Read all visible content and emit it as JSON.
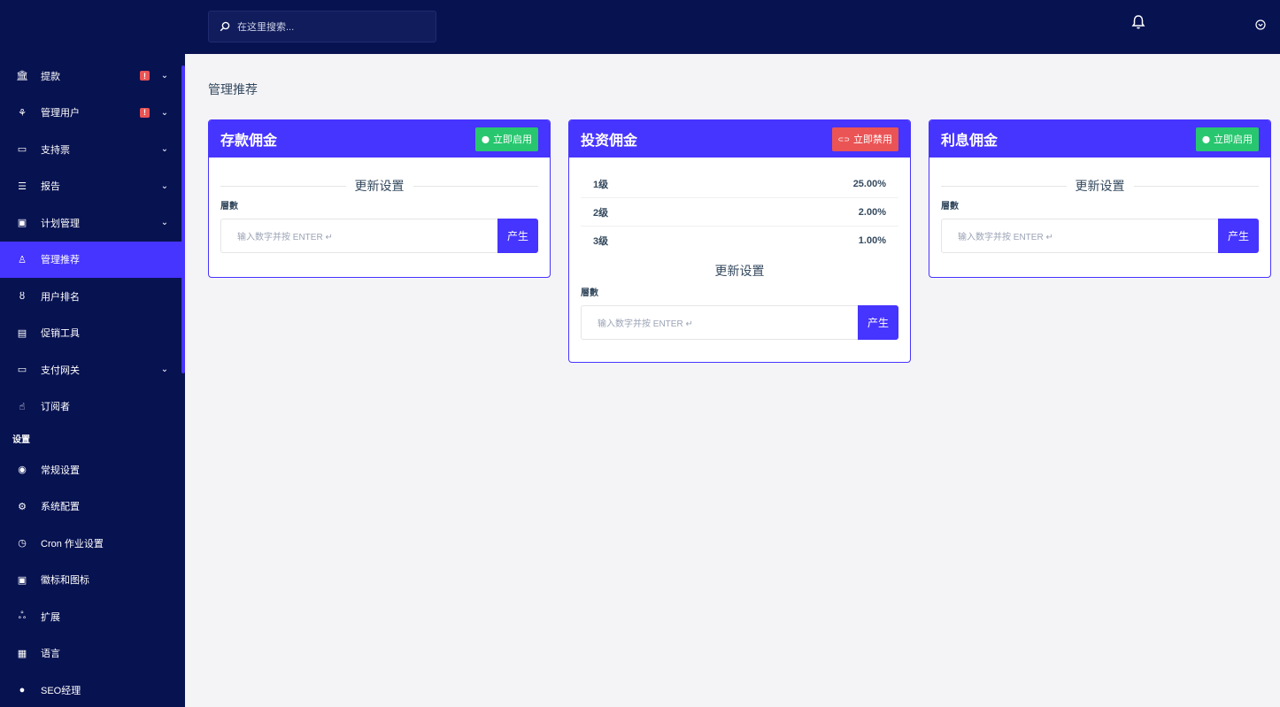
{
  "sidebar": {
    "items": [
      {
        "label": "提款",
        "icon": "bank-icon",
        "glyph": "🏛",
        "warn": true,
        "chevron": true,
        "active": false
      },
      {
        "label": "管理用户",
        "icon": "users-icon",
        "glyph": "⚘",
        "warn": true,
        "chevron": true,
        "active": false
      },
      {
        "label": "支持票",
        "icon": "ticket-icon",
        "glyph": "▭",
        "warn": false,
        "chevron": true,
        "active": false
      },
      {
        "label": "报告",
        "icon": "list-icon",
        "glyph": "☰",
        "warn": false,
        "chevron": true,
        "active": false
      },
      {
        "label": "计划管理",
        "icon": "clipboard-icon",
        "glyph": "▣",
        "warn": false,
        "chevron": true,
        "active": false
      },
      {
        "label": "管理推荐",
        "icon": "referral-icon",
        "glyph": "♙",
        "warn": false,
        "chevron": false,
        "active": true
      },
      {
        "label": "用户排名",
        "icon": "medal-icon",
        "glyph": "ȣ",
        "warn": false,
        "chevron": false,
        "active": false
      },
      {
        "label": "促销工具",
        "icon": "ad-icon",
        "glyph": "▤",
        "warn": false,
        "chevron": false,
        "active": false
      },
      {
        "label": "支付网关",
        "icon": "card-icon",
        "glyph": "▭",
        "warn": false,
        "chevron": true,
        "active": false
      },
      {
        "label": "订阅者",
        "icon": "thumb-up-icon",
        "glyph": "☝",
        "warn": false,
        "chevron": false,
        "active": false
      }
    ],
    "settings_title": "设置",
    "settings_items": [
      {
        "label": "常规设置",
        "icon": "lifebuoy-icon",
        "glyph": "◉"
      },
      {
        "label": "系统配置",
        "icon": "gear-icon",
        "glyph": "⚙"
      },
      {
        "label": "Cron 作业设置",
        "icon": "clock-icon",
        "glyph": "◷"
      },
      {
        "label": "徽标和图标",
        "icon": "image-icon",
        "glyph": "▣"
      },
      {
        "label": "扩展",
        "icon": "puzzle-icon",
        "glyph": "ஃ"
      },
      {
        "label": "语言",
        "icon": "language-icon",
        "glyph": "▦"
      },
      {
        "label": "SEO经理",
        "icon": "globe-icon",
        "glyph": "●"
      }
    ]
  },
  "topbar": {
    "search_placeholder": "在这里搜索..."
  },
  "page_title": "管理推荐",
  "cards": {
    "deposit": {
      "title": "存款佣金",
      "toggle_label": "立即启用",
      "section": "更新设置",
      "field_label": "層數",
      "input_placeholder": "输入数字并按 ENTER ↵",
      "button": "产生"
    },
    "invest": {
      "title": "投资佣金",
      "toggle_label": "立即禁用",
      "levels": [
        {
          "name": "1级",
          "value": "25.00%"
        },
        {
          "name": "2级",
          "value": "2.00%"
        },
        {
          "name": "3级",
          "value": "1.00%"
        }
      ],
      "section": "更新设置",
      "field_label": "層數",
      "input_placeholder": "输入数字并按 ENTER ↵",
      "button": "产生"
    },
    "interest": {
      "title": "利息佣金",
      "toggle_label": "立即启用",
      "section": "更新设置",
      "field_label": "層數",
      "input_placeholder": "输入数字并按 ENTER ↵",
      "button": "产生"
    }
  },
  "colors": {
    "primary": "#4634ff",
    "sidebar": "#071251",
    "success": "#28c76f",
    "danger": "#ea5455"
  }
}
